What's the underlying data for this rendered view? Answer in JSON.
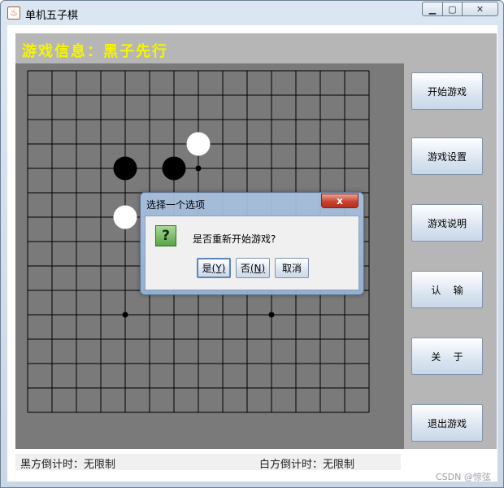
{
  "window": {
    "title": "单机五子棋",
    "icon": "java-cup-icon"
  },
  "info_bar": {
    "text": "游戏信息：黑子先行",
    "color": "#f5f500"
  },
  "board": {
    "size": 15,
    "star_points": [
      [
        7,
        4
      ],
      [
        4,
        10
      ],
      [
        10,
        10
      ]
    ],
    "stones": [
      {
        "color": "white",
        "col": 7,
        "row": 3
      },
      {
        "color": "black",
        "col": 4,
        "row": 4
      },
      {
        "color": "black",
        "col": 6,
        "row": 4
      },
      {
        "color": "white",
        "col": 4,
        "row": 6
      }
    ]
  },
  "side_buttons": [
    "开始游戏",
    "游戏设置",
    "游戏说明",
    "认    输",
    "关    于",
    "退出游戏"
  ],
  "status": {
    "black_timer": "黑方倒计时：无限制",
    "white_timer": "白方倒计时：无限制"
  },
  "dialog": {
    "title": "选择一个选项",
    "close_label": "x",
    "icon": "question-icon",
    "icon_glyph": "?",
    "message": "是否重新开始游戏?",
    "yes_label": "是",
    "yes_mnemonic": "(Y)",
    "no_label": "否",
    "no_mnemonic": "(N)",
    "cancel_label": "取消"
  },
  "watermark": "CSDN @惊弦"
}
